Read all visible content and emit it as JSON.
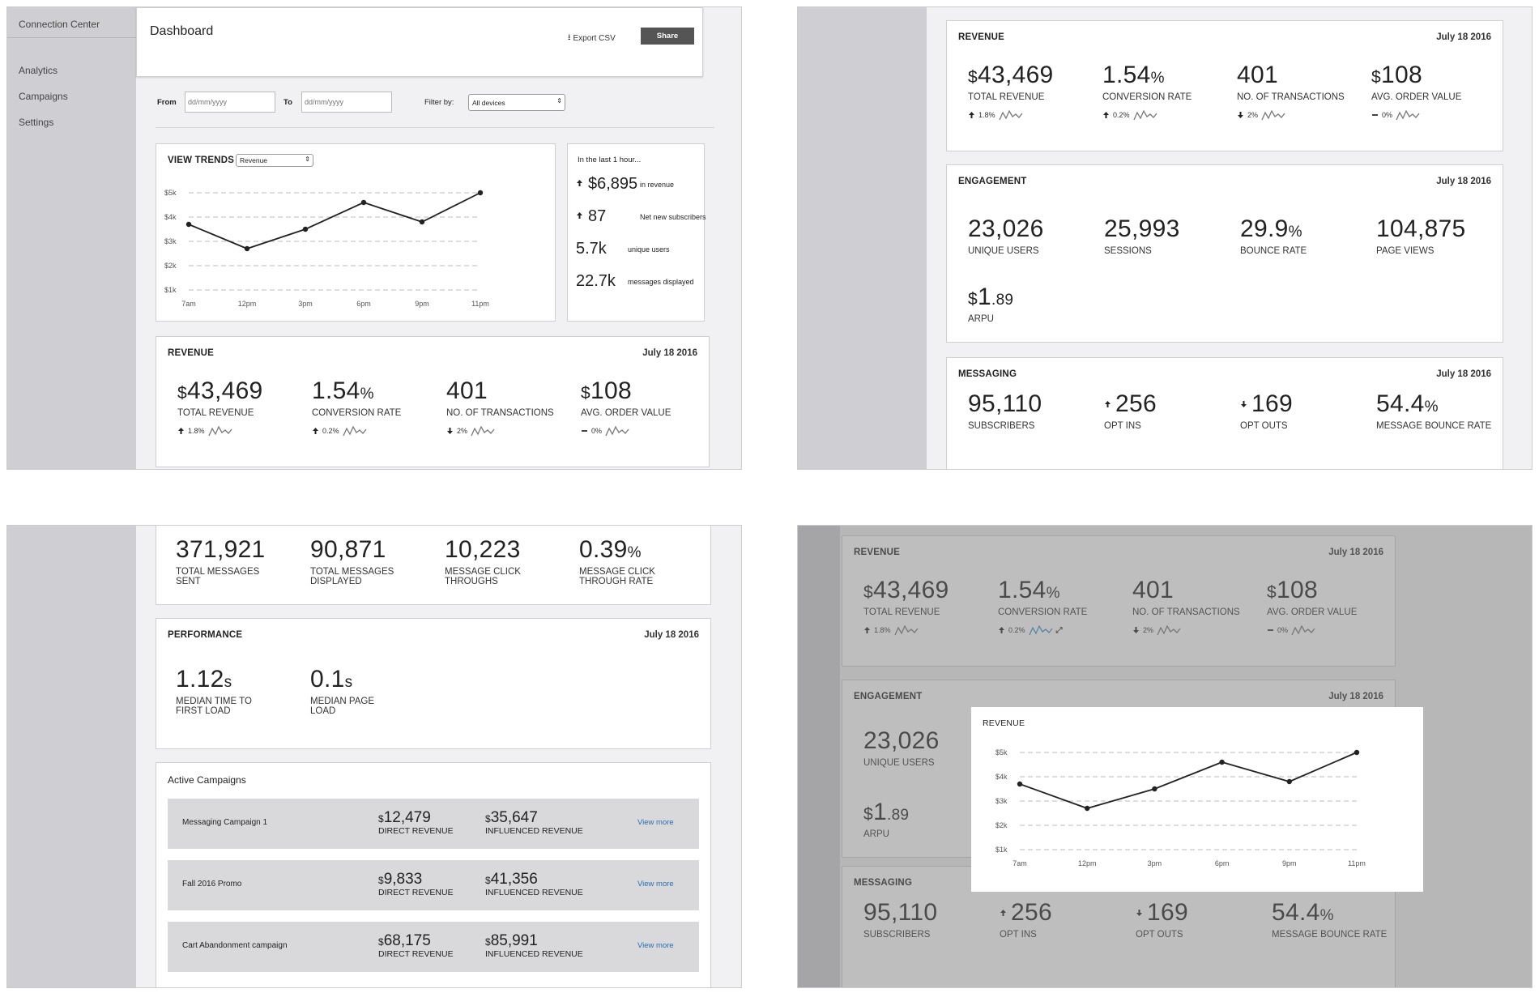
{
  "app": {
    "brand": "Connection Center",
    "nav": [
      "Analytics",
      "Campaigns",
      "Settings"
    ]
  },
  "header": {
    "title": "Dashboard",
    "export_label": "Export CSV",
    "share_label": "Share"
  },
  "filters": {
    "from_label": "From",
    "from_placeholder": "dd/mm/yyyy",
    "to_label": "To",
    "to_placeholder": "dd/mm/yyyy",
    "filter_label": "Filter by:",
    "filter_value": "All devices"
  },
  "trends": {
    "title": "VIEW TRENDS",
    "select_value": "Revenue"
  },
  "chart_data": {
    "type": "line",
    "x": [
      "7am",
      "12pm",
      "3pm",
      "6pm",
      "9pm",
      "11pm"
    ],
    "values": [
      3700,
      2700,
      3500,
      4600,
      3800,
      5000
    ],
    "ylabels": [
      "$5k",
      "$4k",
      "$3k",
      "$2k",
      "$1k"
    ],
    "ylim": [
      1000,
      5000
    ],
    "grid": true
  },
  "last_hour": {
    "title": "In the last 1 hour...",
    "items": [
      {
        "value": "$6,895",
        "label": "in revenue",
        "arrow": "up"
      },
      {
        "value": "87",
        "label": "Net new subscribers",
        "arrow": "up"
      },
      {
        "value": "5.7k",
        "label": "unique users",
        "arrow": ""
      },
      {
        "value": "22.7k",
        "label": "messages displayed",
        "arrow": ""
      }
    ]
  },
  "revenue": {
    "title": "REVENUE",
    "date": "July 18 2016",
    "metrics": [
      {
        "cur": "$",
        "value": "43,469",
        "unit": "",
        "label": "TOTAL REVENUE",
        "trend": "1.8%",
        "dir": "up"
      },
      {
        "cur": "",
        "value": "1.54",
        "unit": "%",
        "label": "CONVERSION RATE",
        "trend": "0.2%",
        "dir": "up"
      },
      {
        "cur": "",
        "value": "401",
        "unit": "",
        "label": "NO. OF TRANSACTIONS",
        "trend": "2%",
        "dir": "down"
      },
      {
        "cur": "$",
        "value": "108",
        "unit": "",
        "label": "AVG. ORDER VALUE",
        "trend": "0%",
        "dir": "flat"
      }
    ]
  },
  "engagement": {
    "title": "ENGAGEMENT",
    "date": "July 18 2016",
    "metrics": [
      {
        "cur": "",
        "value": "23,026",
        "unit": "",
        "label": "UNIQUE USERS"
      },
      {
        "cur": "",
        "value": "25,993",
        "unit": "",
        "label": "SESSIONS"
      },
      {
        "cur": "",
        "value": "29.9",
        "unit": "%",
        "label": "BOUNCE RATE"
      },
      {
        "cur": "",
        "value": "104,875",
        "unit": "",
        "label": "PAGE VIEWS"
      },
      {
        "cur": "$",
        "value": "1",
        "unit": ".89",
        "label": "ARPU"
      }
    ]
  },
  "messaging": {
    "title": "MESSAGING",
    "date": "July 18 2016",
    "metrics": [
      {
        "cur": "",
        "value": "95,110",
        "unit": "",
        "label": "SUBSCRIBERS",
        "dir": ""
      },
      {
        "cur": "",
        "value": "256",
        "unit": "",
        "label": "OPT INS",
        "dir": "up"
      },
      {
        "cur": "",
        "value": "169",
        "unit": "",
        "label": "OPT OUTS",
        "dir": "down"
      },
      {
        "cur": "",
        "value": "54.4",
        "unit": "%",
        "label": "MESSAGE BOUNCE RATE",
        "dir": ""
      }
    ],
    "more": [
      {
        "value": "371,921",
        "unit": "",
        "label": "TOTAL MESSAGES SENT"
      },
      {
        "value": "90,871",
        "unit": "",
        "label": "TOTAL MESSAGES DISPLAYED"
      },
      {
        "value": "10,223",
        "unit": "",
        "label": "MESSAGE CLICK THROUGHS"
      },
      {
        "value": "0.39",
        "unit": "%",
        "label": "MESSAGE CLICK THROUGH RATE"
      }
    ]
  },
  "performance": {
    "title": "PERFORMANCE",
    "date": "July 18 2016",
    "metrics": [
      {
        "value": "1.12",
        "unit": "s",
        "label": "MEDIAN TIME TO FIRST LOAD"
      },
      {
        "value": "0.1",
        "unit": "s",
        "label": "MEDIAN PAGE LOAD"
      }
    ]
  },
  "campaigns": {
    "title": "Active Campaigns",
    "view_more": "View more",
    "direct_label": "DIRECT REVENUE",
    "influenced_label": "INFLUENCED REVENUE",
    "rows": [
      {
        "name": "Messaging Campaign 1",
        "direct": "12,479",
        "influenced": "35,647"
      },
      {
        "name": "Fall 2016 Promo",
        "direct": "9,833",
        "influenced": "41,356"
      },
      {
        "name": "Cart Abandonment campaign",
        "direct": "68,175",
        "influenced": "85,991"
      }
    ]
  },
  "popup": {
    "title": "REVENUE"
  },
  "colors": {
    "sidebar": "#cfced2",
    "bg": "#f1f1f3",
    "button": "#555555",
    "link": "#2a6fb0",
    "spark_active": "#3b8fd4"
  }
}
